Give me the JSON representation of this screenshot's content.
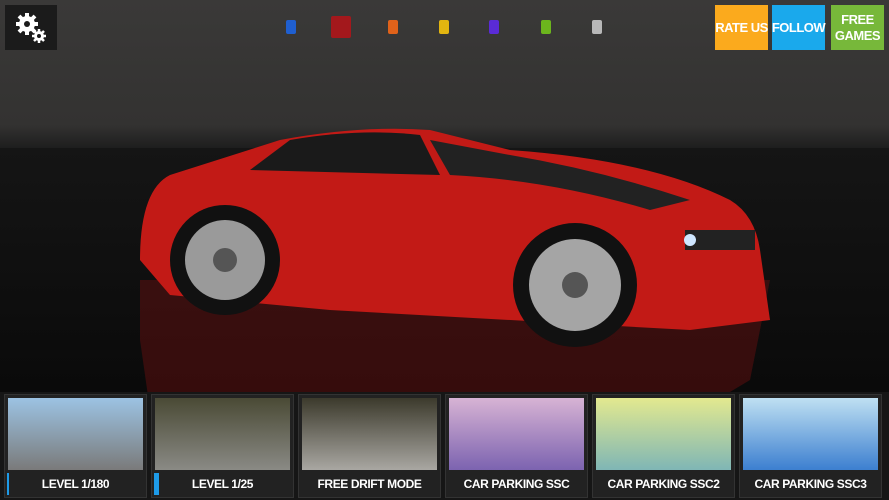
{
  "toolbar": {
    "settings_icon": "gears-icon",
    "rate_us": "RATE US",
    "follow": "FOLLOW",
    "free_games": "FREE GAMES",
    "colors": {
      "rate": "#fbaa1d",
      "follow": "#1aa9ec",
      "free": "#77b83a"
    }
  },
  "swatches": [
    {
      "color": "#1f5fd0",
      "selected": false
    },
    {
      "color": "#a3181c",
      "selected": true
    },
    {
      "color": "#e0621a",
      "selected": false
    },
    {
      "color": "#e2b510",
      "selected": false
    },
    {
      "color": "#5a2bd6",
      "selected": false
    },
    {
      "color": "#6cb51d",
      "selected": false
    },
    {
      "color": "#b8b8b8",
      "selected": false
    }
  ],
  "car": {
    "color": "#c21a16"
  },
  "modes": [
    {
      "label": "LEVEL 1/180",
      "progress": 0.0056,
      "thumb": [
        "#9cc3e3",
        "#7a7a7a"
      ]
    },
    {
      "label": "LEVEL 1/25",
      "progress": 0.04,
      "thumb": [
        "#4a4a35",
        "#8a8a85"
      ]
    },
    {
      "label": "FREE DRIFT MODE",
      "thumb": [
        "#3c3a2c",
        "#a9a7a2"
      ]
    },
    {
      "label": "CAR PARKING SSC",
      "thumb": [
        "#d7b3d4",
        "#7c63b0"
      ]
    },
    {
      "label": "CAR PARKING SSC2",
      "thumb": [
        "#e3e98f",
        "#7fb6b5"
      ]
    },
    {
      "label": "CAR PARKING SSC3",
      "thumb": [
        "#bfe0f2",
        "#3c7fd0"
      ]
    }
  ]
}
